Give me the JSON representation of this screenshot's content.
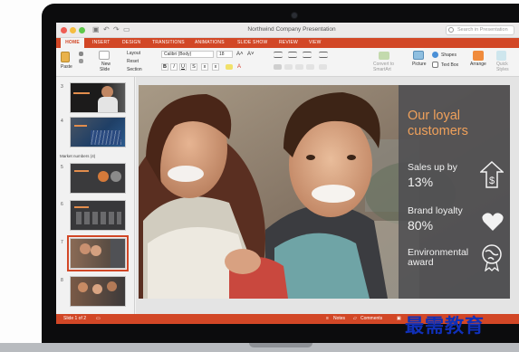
{
  "window": {
    "title": "Northwind Company Presentation",
    "search_placeholder": "Search in Presentation"
  },
  "tabs": [
    "HOME",
    "INSERT",
    "DESIGN",
    "TRANSITIONS",
    "ANIMATIONS",
    "SLIDE SHOW",
    "REVIEW",
    "VIEW"
  ],
  "ribbon": {
    "paste": "Paste",
    "new_slide_1": "New",
    "new_slide_2": "Slide",
    "layout": "Layout",
    "reset": "Reset",
    "section": "Section",
    "font_name": "Calibri (Body)",
    "font_size": "18",
    "bold": "B",
    "italic": "I",
    "underline": "U",
    "convert_1": "Convert to",
    "convert_2": "SmartArt",
    "picture": "Picture",
    "shapes": "Shapes",
    "text_box": "Text Box",
    "arrange": "Arrange",
    "quick_1": "Quick",
    "quick_2": "Styles"
  },
  "thumbnails": {
    "numbers": [
      "3",
      "4",
      "5",
      "6",
      "7",
      "8"
    ],
    "section_label": "Market numbers (4)"
  },
  "slide": {
    "title": "Our loyal customers",
    "stats": [
      {
        "label": "Sales up by",
        "value": "13%",
        "icon": "dollar-arrow-icon"
      },
      {
        "label": "Brand loyalty",
        "value": "80%",
        "icon": "heart-icon"
      },
      {
        "label": "Environmental award",
        "value": "",
        "icon": "globe-award-icon"
      }
    ]
  },
  "status": {
    "slide_indicator": "Slide 1 of 2",
    "notes": "Notes",
    "comments": "Comments"
  },
  "watermark": "最需教育",
  "colors": {
    "accent": "#d24726",
    "slide_title": "#f0a15b",
    "overlay": "#4e4f52"
  }
}
